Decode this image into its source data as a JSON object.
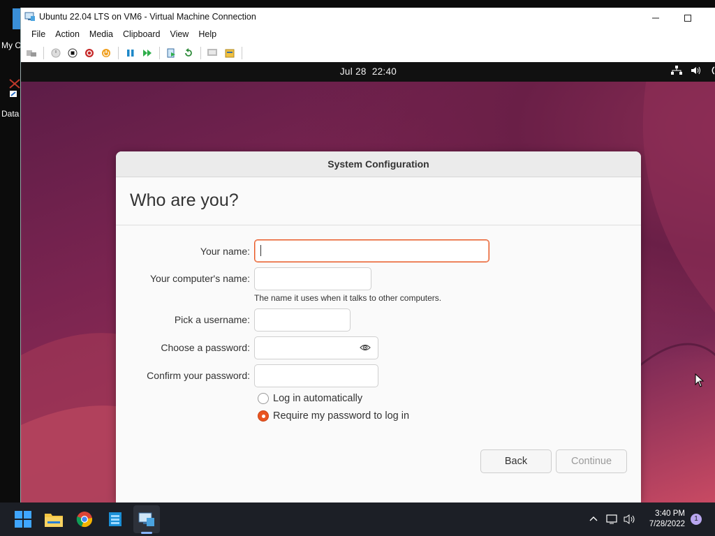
{
  "desktop": {
    "icons": [
      {
        "label": "My C",
        "icon": "computer-icon"
      },
      {
        "label": "Data",
        "icon": "shortcut-icon"
      }
    ]
  },
  "vm_window": {
    "title": "Ubuntu 22.04 LTS on VM6 - Virtual Machine Connection",
    "menu": [
      "File",
      "Action",
      "Media",
      "Clipboard",
      "View",
      "Help"
    ],
    "toolbar": [
      "ctrl-alt-del-icon",
      "start-icon",
      "turn-off-icon",
      "shut-down-icon",
      "power-icon",
      "pause-icon",
      "resume-icon",
      "checkpoint-icon",
      "revert-icon",
      "enhanced-session-icon",
      "share-icon"
    ]
  },
  "guest": {
    "topbar": {
      "date": "Jul 28",
      "time": "22:40"
    },
    "dialog": {
      "title": "System Configuration",
      "heading": "Who are you?",
      "fields": {
        "your_name": {
          "label": "Your name:",
          "value": ""
        },
        "computer_name": {
          "label": "Your computer's name:",
          "value": "",
          "hint": "The name it uses when it talks to other computers."
        },
        "username": {
          "label": "Pick a username:",
          "value": ""
        },
        "password": {
          "label": "Choose a password:",
          "value": ""
        },
        "confirm_password": {
          "label": "Confirm your password:",
          "value": ""
        }
      },
      "login_options": {
        "auto": {
          "label": "Log in automatically",
          "selected": false
        },
        "require_password": {
          "label": "Require my password to log in",
          "selected": true
        }
      },
      "buttons": {
        "back": "Back",
        "continue": "Continue"
      }
    }
  },
  "taskbar": {
    "apps": [
      "windows-start-icon",
      "file-explorer-icon",
      "chrome-icon",
      "azure-data-studio-icon",
      "hyper-v-icon"
    ],
    "clock": {
      "time": "3:40 PM",
      "date": "7/28/2022"
    },
    "notifications": "1"
  },
  "colors": {
    "accent": "#E95420",
    "taskbar": "#1C1F26"
  }
}
